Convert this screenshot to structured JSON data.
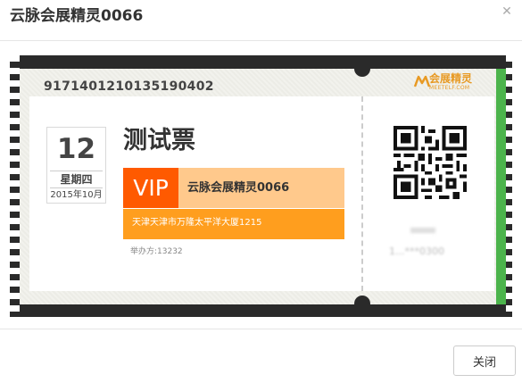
{
  "dialog": {
    "title": "云脉会展精灵0066",
    "close_label": "关闭",
    "close_icon": "close-icon"
  },
  "ticket": {
    "serial": "9171401210135190402",
    "logo": {
      "name": "会展精灵",
      "sub": "MEETELF.COM"
    },
    "date": {
      "day": "12",
      "weekday": "星期四",
      "month": "2015年10月"
    },
    "name": "测试票",
    "badge": "VIP",
    "event": "云脉会展精灵0066",
    "address": "天津天津市万隆太平洋大厦1215",
    "organizer": "举办方:13232",
    "holder_blurred": "1...***0300"
  },
  "colors": {
    "frame": "#2a2a2a",
    "vip_badge": "#ff5a00",
    "vip_bar": "#ffc98c",
    "address_bar": "#ff9e1e",
    "edge_green": "#4cb44c",
    "logo_orange": "#e89a24"
  }
}
